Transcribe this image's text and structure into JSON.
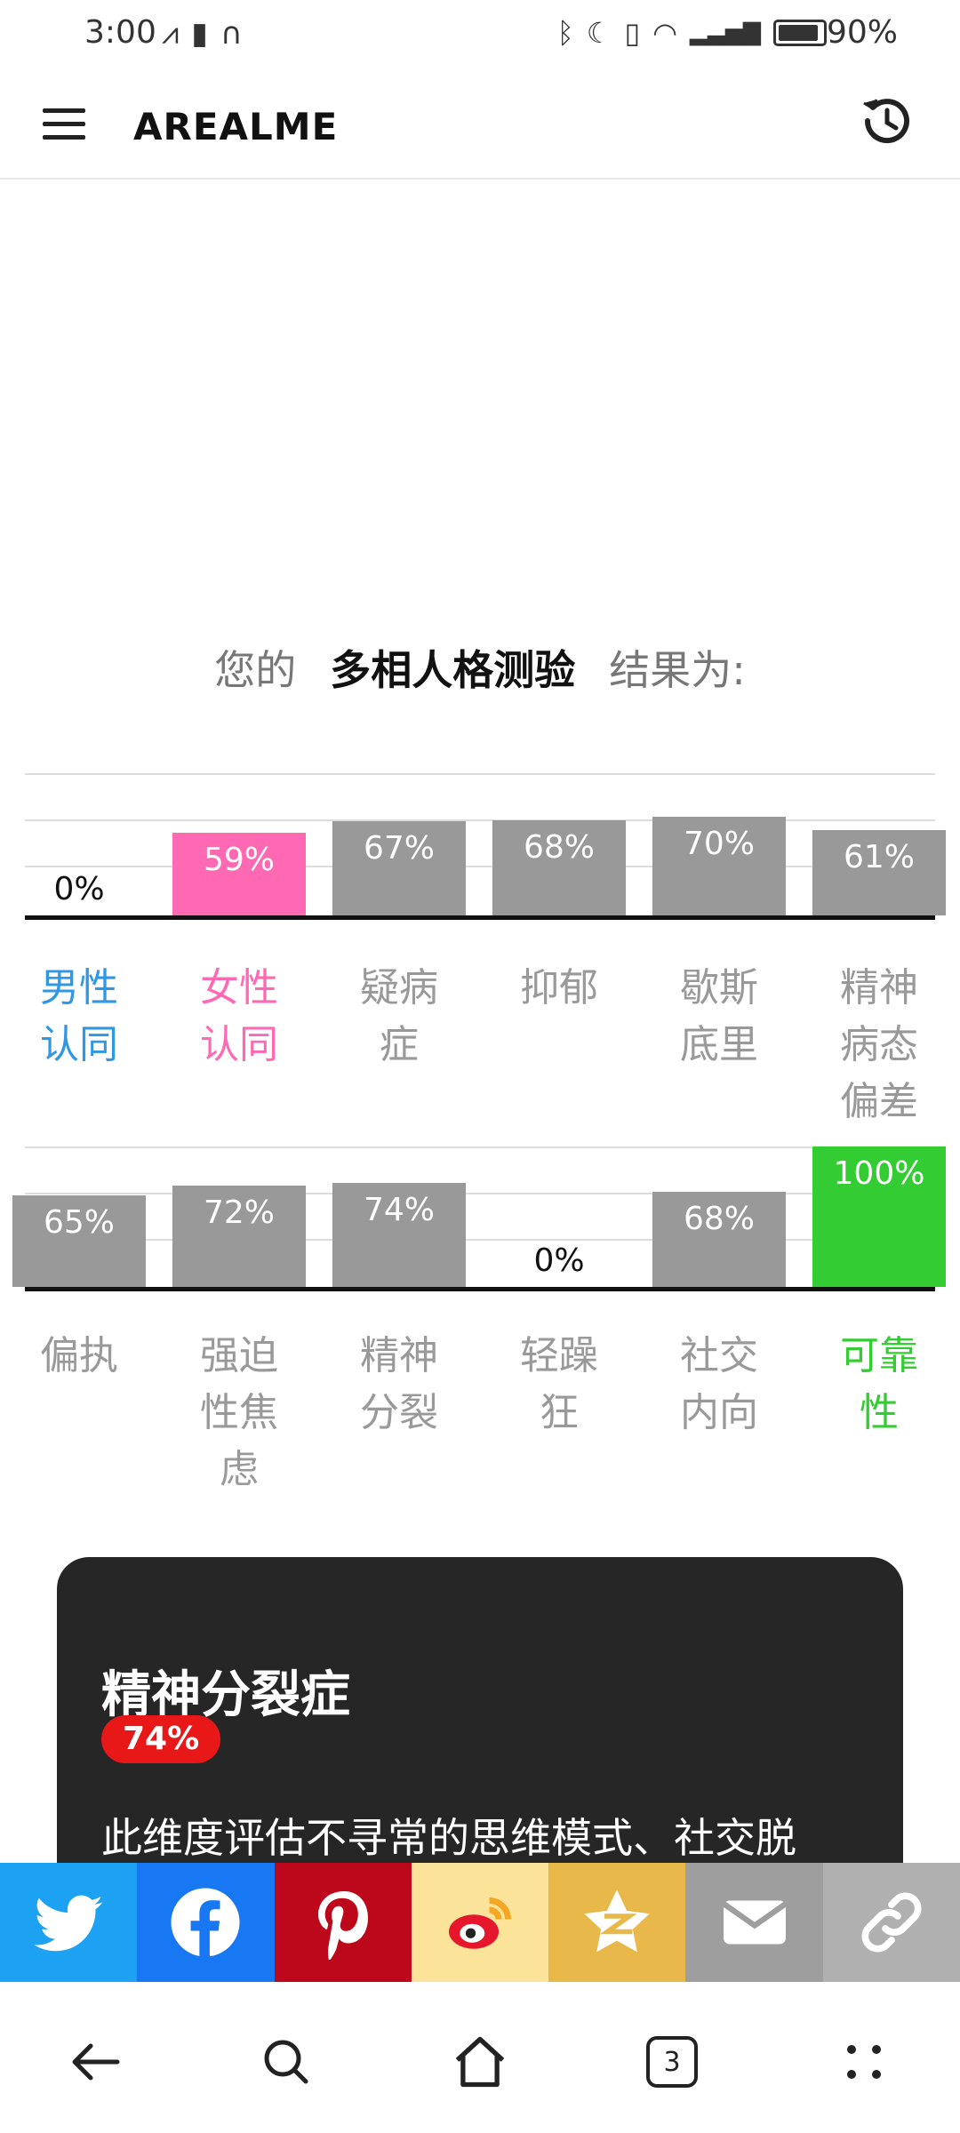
{
  "status_bar": {
    "time": "3:00",
    "battery": "90%"
  },
  "app": {
    "brand": "AREALME"
  },
  "heading": {
    "prefix": "您的",
    "test_name": "多相人格测验",
    "suffix": "结果为:"
  },
  "colors": {
    "male": "#2f97e3",
    "female": "#ff69b4",
    "neutral": "#999999",
    "reliable": "#33cc33",
    "highlight_badge": "#e81818"
  },
  "chart_data": [
    {
      "type": "bar",
      "categories": [
        "男性认同",
        "女性认同",
        "疑病症",
        "抑郁",
        "歇斯底里",
        "精神病态偏差"
      ],
      "values": [
        0,
        59,
        67,
        68,
        70,
        61
      ],
      "value_labels": [
        "0%",
        "59%",
        "67%",
        "68%",
        "70%",
        "61%"
      ],
      "ylim": [
        0,
        100
      ]
    },
    {
      "type": "bar",
      "categories": [
        "偏执",
        "强迫性焦虑",
        "精神分裂",
        "轻躁狂",
        "社交内向",
        "可靠性"
      ],
      "values": [
        65,
        72,
        74,
        0,
        68,
        100
      ],
      "value_labels": [
        "65%",
        "72%",
        "74%",
        "0%",
        "68%",
        "100%"
      ],
      "ylim": [
        0,
        100
      ]
    }
  ],
  "chart1_labels": [
    [
      "男性",
      "认同"
    ],
    [
      "女性",
      "认同"
    ],
    [
      "疑病",
      "症"
    ],
    [
      "抑郁"
    ],
    [
      "歇斯",
      "底里"
    ],
    [
      "精神",
      "病态",
      "偏差"
    ]
  ],
  "chart2_labels": [
    [
      "偏执"
    ],
    [
      "强迫",
      "性焦",
      "虑"
    ],
    [
      "精神",
      "分裂"
    ],
    [
      "轻躁",
      "狂"
    ],
    [
      "社交",
      "内向"
    ],
    [
      "可靠",
      "性"
    ]
  ],
  "card": {
    "title": "精神分裂症",
    "percent": "74%",
    "description": "此维度评估不寻常的思维模式、社交脱"
  },
  "share": [
    "twitter-icon",
    "facebook-icon",
    "pinterest-icon",
    "weibo-icon",
    "qzone-icon",
    "email-icon",
    "link-icon"
  ],
  "navbar": {
    "tab_count": "3"
  }
}
